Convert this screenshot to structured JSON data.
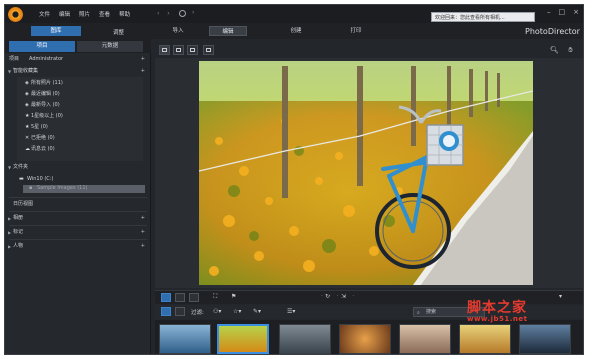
{
  "app": {
    "name": "PhotoDirector"
  },
  "menu": [
    "文件",
    "编辑",
    "照片",
    "查看",
    "帮助"
  ],
  "notice": "欢迎回来：您此查看所有相机...",
  "top_tabs": {
    "library": "图库",
    "adjust": "调整"
  },
  "modes": [
    "导入",
    "编辑",
    "创建",
    "打印"
  ],
  "left_panel": {
    "tab_project": "项目",
    "tab_metadata": "元数据",
    "project_label": "项目",
    "user": "Administrator",
    "smart_collections": "智能收藏集",
    "collections": [
      {
        "label": "所有照片 (11)"
      },
      {
        "label": "最近编辑 (0)"
      },
      {
        "label": "最新导入 (0)"
      },
      {
        "label": "1星级以上 (0)"
      },
      {
        "label": "5星 (0)"
      },
      {
        "label": "已拒绝 (0)"
      },
      {
        "label": "讯息云 (0)"
      }
    ],
    "folders_label": "文件夹",
    "drive": "Win10 (C:)",
    "folder_selected": "Sample Images (11)",
    "sections": [
      "日历视图",
      "相册",
      "标记",
      "人物"
    ]
  },
  "filter": {
    "label": "过滤:",
    "search_placeholder": "搜索"
  },
  "watermark": {
    "title": "脚本之家",
    "url": "www.jb51.net"
  },
  "colors": {
    "accent": "#2f6fb0",
    "selected_border": "#3c8ee0",
    "watermark": "#e53a2e"
  }
}
